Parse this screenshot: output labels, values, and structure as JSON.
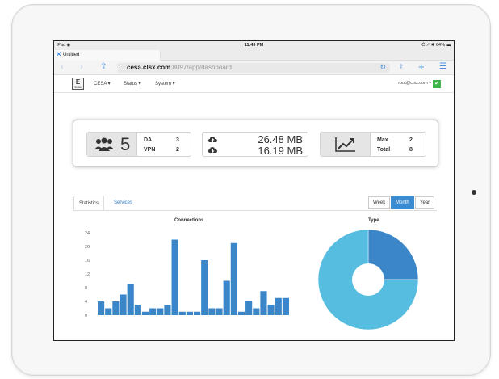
{
  "device": {
    "status_left": "iPad ◉",
    "time": "11:49 PM",
    "status_right": "Ć ↗ ✱ 64% ▬"
  },
  "browser": {
    "tab_title": "Untitled",
    "url_host": "cesa.clsx.com",
    "url_path": ":8097/app/dashboard"
  },
  "nav": {
    "logo_letter": "E",
    "logo_sub": "Series",
    "items": [
      "CESA ▾",
      "Status ▾",
      "System ▾"
    ],
    "user": "root@clsx.com ▾",
    "check": "✔"
  },
  "summary": {
    "users_count": "5",
    "da_label": "DA",
    "da_value": "3",
    "vpn_label": "VPN",
    "vpn_value": "2",
    "upload": "26.48 MB",
    "download": "16.19 MB",
    "max_label": "Max",
    "max_value": "2",
    "total_label": "Total",
    "total_value": "8"
  },
  "panel": {
    "tabs": [
      "Statistics",
      "Services"
    ],
    "ranges": [
      "Week",
      "Month",
      "Year"
    ],
    "active_range": "Month"
  },
  "colors": {
    "accent": "#3a8bd0",
    "bar": "#3a86c8",
    "pie_main": "#56bde0",
    "pie_slice": "#3a86c8",
    "ok_green": "#3cb44a"
  },
  "chart_data": [
    {
      "type": "bar",
      "title": "Connections",
      "ylim": [
        0,
        24
      ],
      "yticks": [
        "0",
        "4",
        "8",
        "12",
        "16",
        "20",
        "24"
      ],
      "values": [
        4,
        2,
        4,
        6,
        9,
        3,
        1,
        2,
        2,
        3,
        22,
        1,
        1,
        1,
        16,
        2,
        2,
        10,
        21,
        1,
        4,
        2,
        7,
        3,
        5,
        5
      ],
      "grid": false
    },
    {
      "type": "pie",
      "title": "Type",
      "values": [
        25,
        75
      ],
      "donut": true
    }
  ]
}
